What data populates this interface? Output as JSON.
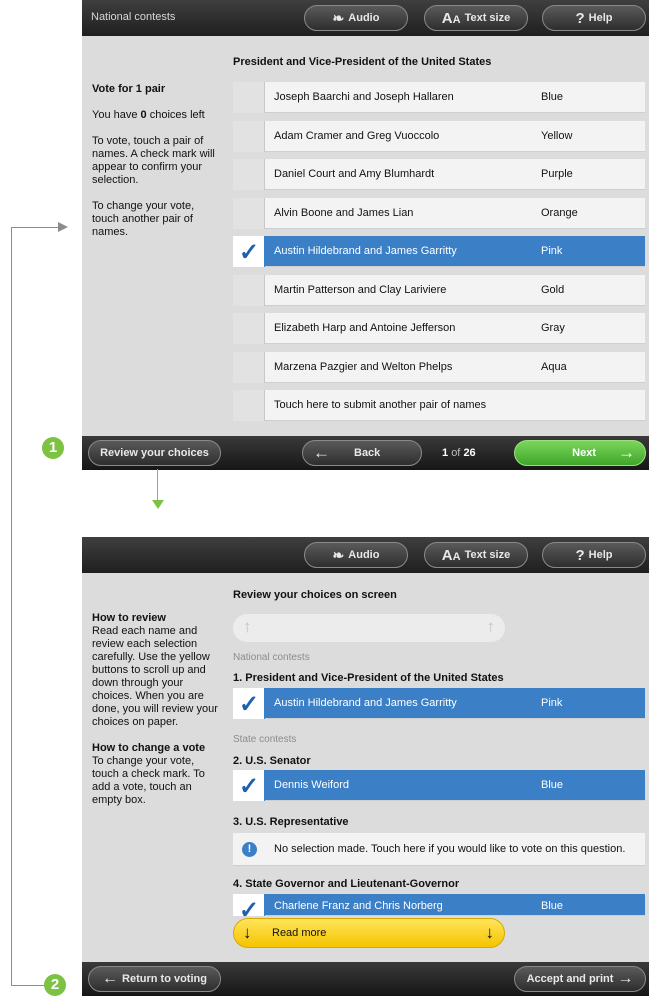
{
  "screen1": {
    "header": {
      "title": "National contests",
      "audio_label": "Audio",
      "text_size_label": "Text size",
      "help_label": "Help"
    },
    "side": {
      "heading": "Vote for 1 pair",
      "choices_prefix": "You have ",
      "choices_count": "0",
      "choices_suffix": " choices left",
      "instruction1": "To vote, touch a pair of names. A check mark will appear to confirm your selection.",
      "instruction2": "To change your vote, touch another pair of names."
    },
    "contest_title": "President and Vice-President of the United States",
    "candidates": [
      {
        "name": "Joseph Baarchi and Joseph Hallaren",
        "party": "Blue",
        "selected": false
      },
      {
        "name": "Adam Cramer and Greg Vuoccolo",
        "party": "Yellow",
        "selected": false
      },
      {
        "name": "Daniel Court and Amy Blumhardt",
        "party": "Purple",
        "selected": false
      },
      {
        "name": "Alvin Boone and James Lian",
        "party": "Orange",
        "selected": false
      },
      {
        "name": "Austin Hildebrand and James Garritty",
        "party": "Pink",
        "selected": true
      },
      {
        "name": "Martin Patterson and Clay Lariviere",
        "party": "Gold",
        "selected": false
      },
      {
        "name": "Elizabeth Harp and Antoine Jefferson",
        "party": "Gray",
        "selected": false
      },
      {
        "name": "Marzena Pazgier and Welton Phelps",
        "party": "Aqua",
        "selected": false
      },
      {
        "name": "Touch here to submit another pair of names",
        "party": "",
        "selected": false
      }
    ],
    "footer": {
      "review_label": "Review your choices",
      "back_label": "Back",
      "page_current": "1",
      "page_of": "of",
      "page_total": "26",
      "next_label": "Next"
    }
  },
  "screen2": {
    "header": {
      "audio_label": "Audio",
      "text_size_label": "Text size",
      "help_label": "Help"
    },
    "side": {
      "heading1": "How to review",
      "text1": "Read each name and review each selection carefully. Use the yellow buttons to scroll up and down through your choices. When you are done, you will review your choices on paper.",
      "heading2": "How to change a vote",
      "text2": "To change your vote, touch a check mark. To add a vote, touch an empty box."
    },
    "review_title": "Review your choices on screen",
    "national_label": "National contests",
    "contest1_title": "1. President and Vice-President of the United States",
    "contest1_name": "Austin Hildebrand and James Garritty",
    "contest1_party": "Pink",
    "state_label": "State contests",
    "contest2_title": "2. U.S. Senator",
    "contest2_name": "Dennis Weiford",
    "contest2_party": "Blue",
    "contest3_title": "3. U.S. Representative",
    "contest3_text": "No selection made. Touch here if you would like to vote on this question.",
    "contest4_title": "4. State Governor and Lieutenant-Governor",
    "contest4_name": "Charlene Franz and Chris Norberg",
    "contest4_party": "Blue",
    "read_more_label": "Read more",
    "footer": {
      "return_label": "Return to voting",
      "accept_label": "Accept and print"
    }
  },
  "annotations": {
    "step1": "1",
    "step2": "2"
  },
  "colors": {
    "selected_blue": "#3b7fc6",
    "next_green": "#5cc23f",
    "badge_green": "#7dc242",
    "read_more_yellow": "#fcd21a"
  }
}
